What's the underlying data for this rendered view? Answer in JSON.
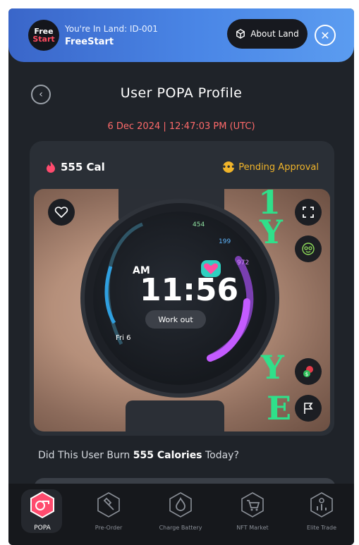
{
  "banner": {
    "logo_line1": "Free",
    "logo_line2": "Start",
    "land_label": "You're In Land: ID-001",
    "land_name": "FreeStart",
    "about_button": "About Land"
  },
  "header": {
    "title": "User POPA Profile",
    "timestamp": "6 Dec 2024 | 12:47:03 PM (UTC)"
  },
  "card": {
    "calories": "555 Cal",
    "status": "Pending Approval",
    "watch": {
      "ampm": "AM",
      "time": "11:56",
      "activity": "Work out",
      "date": "Fri 6"
    },
    "annotations": [
      "1",
      "Y",
      "Y",
      "E"
    ]
  },
  "question": {
    "prefix": "Did This User Burn ",
    "highlight": "555 Calories",
    "suffix": " Today?"
  },
  "nav": {
    "items": [
      {
        "label": "POPA",
        "active": true
      },
      {
        "label": "Pre-Order",
        "active": false
      },
      {
        "label": "Charge Battery",
        "active": false
      },
      {
        "label": "NFT Market",
        "active": false
      },
      {
        "label": "Elite Trade",
        "active": false
      }
    ]
  },
  "colors": {
    "accent_pink": "#ff4b6e",
    "status_amber": "#f0b42a",
    "timestamp_red": "#ff6a6a",
    "banner_blue": "#4a86e6"
  }
}
